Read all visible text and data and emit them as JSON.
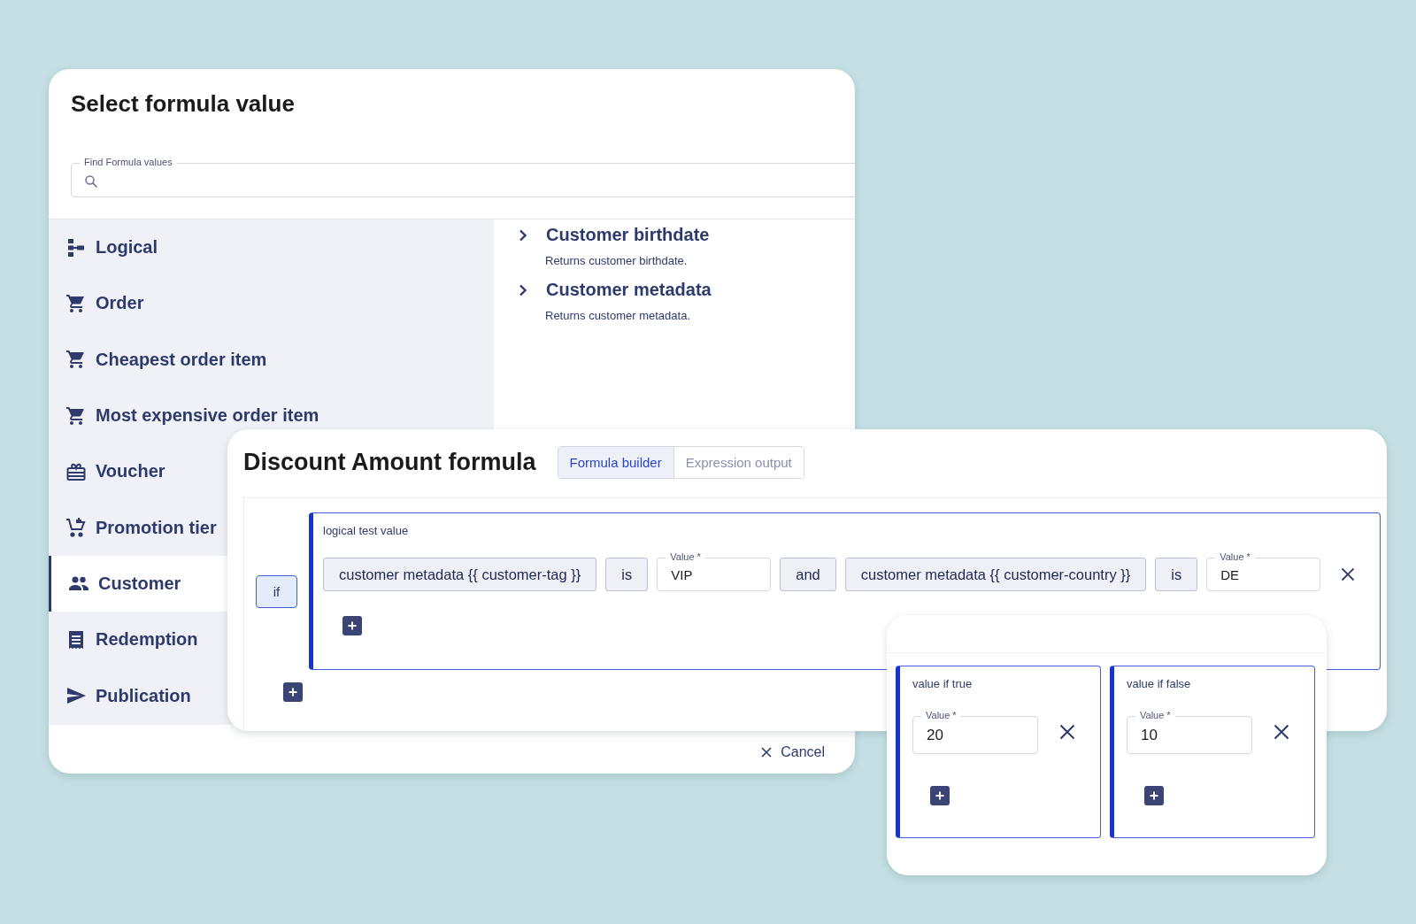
{
  "dialog": {
    "title": "Select formula value",
    "search": {
      "label": "Find Formula values"
    },
    "categories": [
      {
        "label": "Logical",
        "selected": false
      },
      {
        "label": "Order",
        "selected": false
      },
      {
        "label": "Cheapest order item",
        "selected": false
      },
      {
        "label": "Most expensive order item",
        "selected": false
      },
      {
        "label": "Voucher",
        "selected": false
      },
      {
        "label": "Promotion tier",
        "selected": false
      },
      {
        "label": "Customer",
        "selected": true
      },
      {
        "label": "Redemption",
        "selected": false
      },
      {
        "label": "Publication",
        "selected": false
      }
    ],
    "results": [
      {
        "title": "Customer birthdate",
        "description": "Returns customer birthdate.",
        "expanded": false
      },
      {
        "title": "Customer metadata",
        "description": "Returns customer metadata.",
        "expanded": false
      }
    ],
    "cancel_button": "Cancel"
  },
  "formula": {
    "title": "Discount Amount formula",
    "tabs": [
      {
        "label": "Formula builder",
        "selected": true
      },
      {
        "label": "Expression output",
        "selected": false
      }
    ],
    "condition_button": "if",
    "logical_test": {
      "label": "logical test value",
      "tokens": [
        {
          "kind": "chip",
          "text": "customer metadata {{ customer-tag }}"
        },
        {
          "kind": "chip",
          "text": "is"
        },
        {
          "kind": "field",
          "label": "Value *",
          "value": "VIP"
        },
        {
          "kind": "chip",
          "text": "and"
        },
        {
          "kind": "chip",
          "text": "customer metadata {{ customer-country }}"
        },
        {
          "kind": "chip",
          "text": "is"
        },
        {
          "kind": "field",
          "label": "Value *",
          "value": "DE"
        }
      ]
    }
  },
  "branches": [
    {
      "label": "value if true",
      "field_label": "Value *",
      "value": "20"
    },
    {
      "label": "value if false",
      "field_label": "Value *",
      "value": "10"
    }
  ]
}
